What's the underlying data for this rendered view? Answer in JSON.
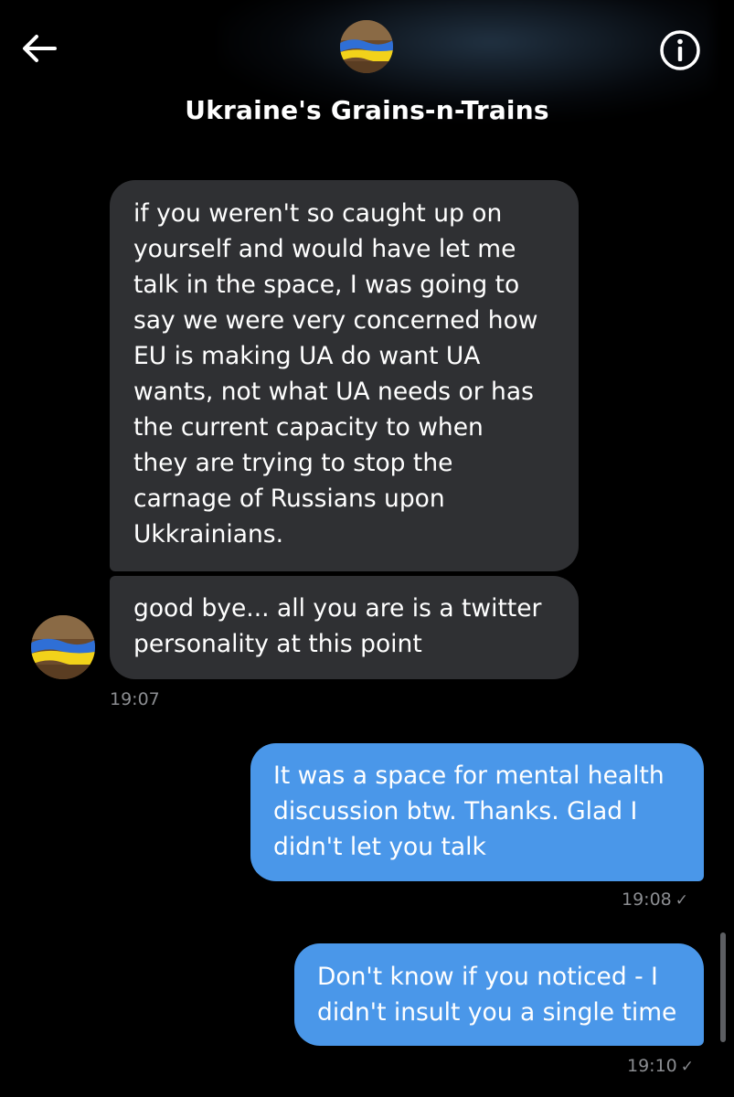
{
  "header": {
    "title": "Ukraine's Grains-n-Trains",
    "back_icon": "arrow-left-icon",
    "info_icon": "info-circle-icon"
  },
  "messages": [
    {
      "direction": "received",
      "text": "if you weren't so caught up on\nyourself and would have let me\ntalk in the space, I was going to\nsay we were very concerned how\nEU is making UA do want UA\nwants, not what UA needs or has\nthe current capacity to when\nthey are trying to stop the\ncarnage of Russians upon\nUkkrainians."
    },
    {
      "direction": "received",
      "text": "good bye... all you are is a twitter\npersonality at this point",
      "time": "19:07"
    },
    {
      "direction": "sent",
      "text": "It was a space for mental health\ndiscussion btw. Thanks. Glad I\ndidn't let you talk",
      "time": "19:08",
      "status": "✓"
    },
    {
      "direction": "sent",
      "text": "Don't know if you noticed - I\ndidn't insult you a single time",
      "time": "19:10",
      "status": "✓"
    }
  ],
  "colors": {
    "background": "#000000",
    "received_bubble": "#2f3033",
    "sent_bubble": "#4a97e9",
    "timestamp": "#8b8d91"
  }
}
